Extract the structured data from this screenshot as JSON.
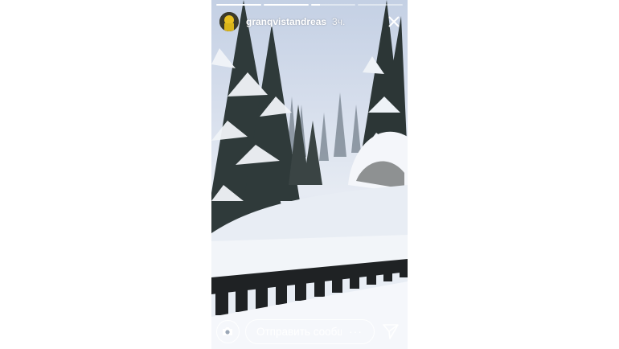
{
  "story": {
    "username": "granqvistandreas",
    "time": "3ч.",
    "progress_segments": [
      {
        "state": "done"
      },
      {
        "state": "done"
      },
      {
        "state": "current",
        "fraction": 0.2
      },
      {
        "state": "pending"
      }
    ]
  },
  "reply": {
    "placeholder": "Отправить сообщение",
    "more_label": "···"
  },
  "icons": {
    "close": "close-icon",
    "camera": "camera-icon",
    "send": "send-icon"
  },
  "colors": {
    "overlay_text": "#ffffff",
    "sky": "#c4d0e4",
    "snow": "#e6ebf3"
  }
}
